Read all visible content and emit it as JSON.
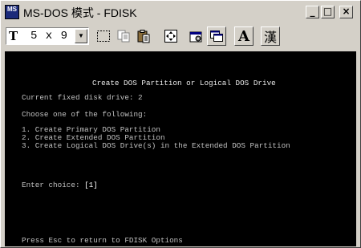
{
  "window": {
    "icon_label": "MS",
    "title": "MS-DOS 模式 - FDISK",
    "buttons": {
      "minimize": "_",
      "maximize": "□",
      "close": "×"
    }
  },
  "toolbar": {
    "font_icon": "T",
    "font_size": "5 x 9",
    "dropdown_arrow": "▼",
    "tools": [
      "mark-icon",
      "copy-icon",
      "paste-icon",
      "fullscreen-icon",
      "properties-icon",
      "background-icon",
      "font-icon",
      "ime-icon"
    ],
    "font_button_label": "A",
    "ime_button_label": "漢"
  },
  "console": {
    "heading": "Create DOS Partition or Logical DOS Drive",
    "current_drive": "Current fixed disk drive: 2",
    "prompt_intro": "Choose one of the following:",
    "options": [
      "1. Create Primary DOS Partition",
      "2. Create Extended DOS Partition",
      "3. Create Logical DOS Drive(s) in the Extended DOS Partition"
    ],
    "enter_choice_label": "Enter choice: ",
    "enter_choice_value": "[1]",
    "footer": "Press Esc to return to FDISK Options"
  },
  "colors": {
    "console_bg": "#000000",
    "console_text": "#c0c0c0",
    "chrome": "#d4d0c8"
  }
}
